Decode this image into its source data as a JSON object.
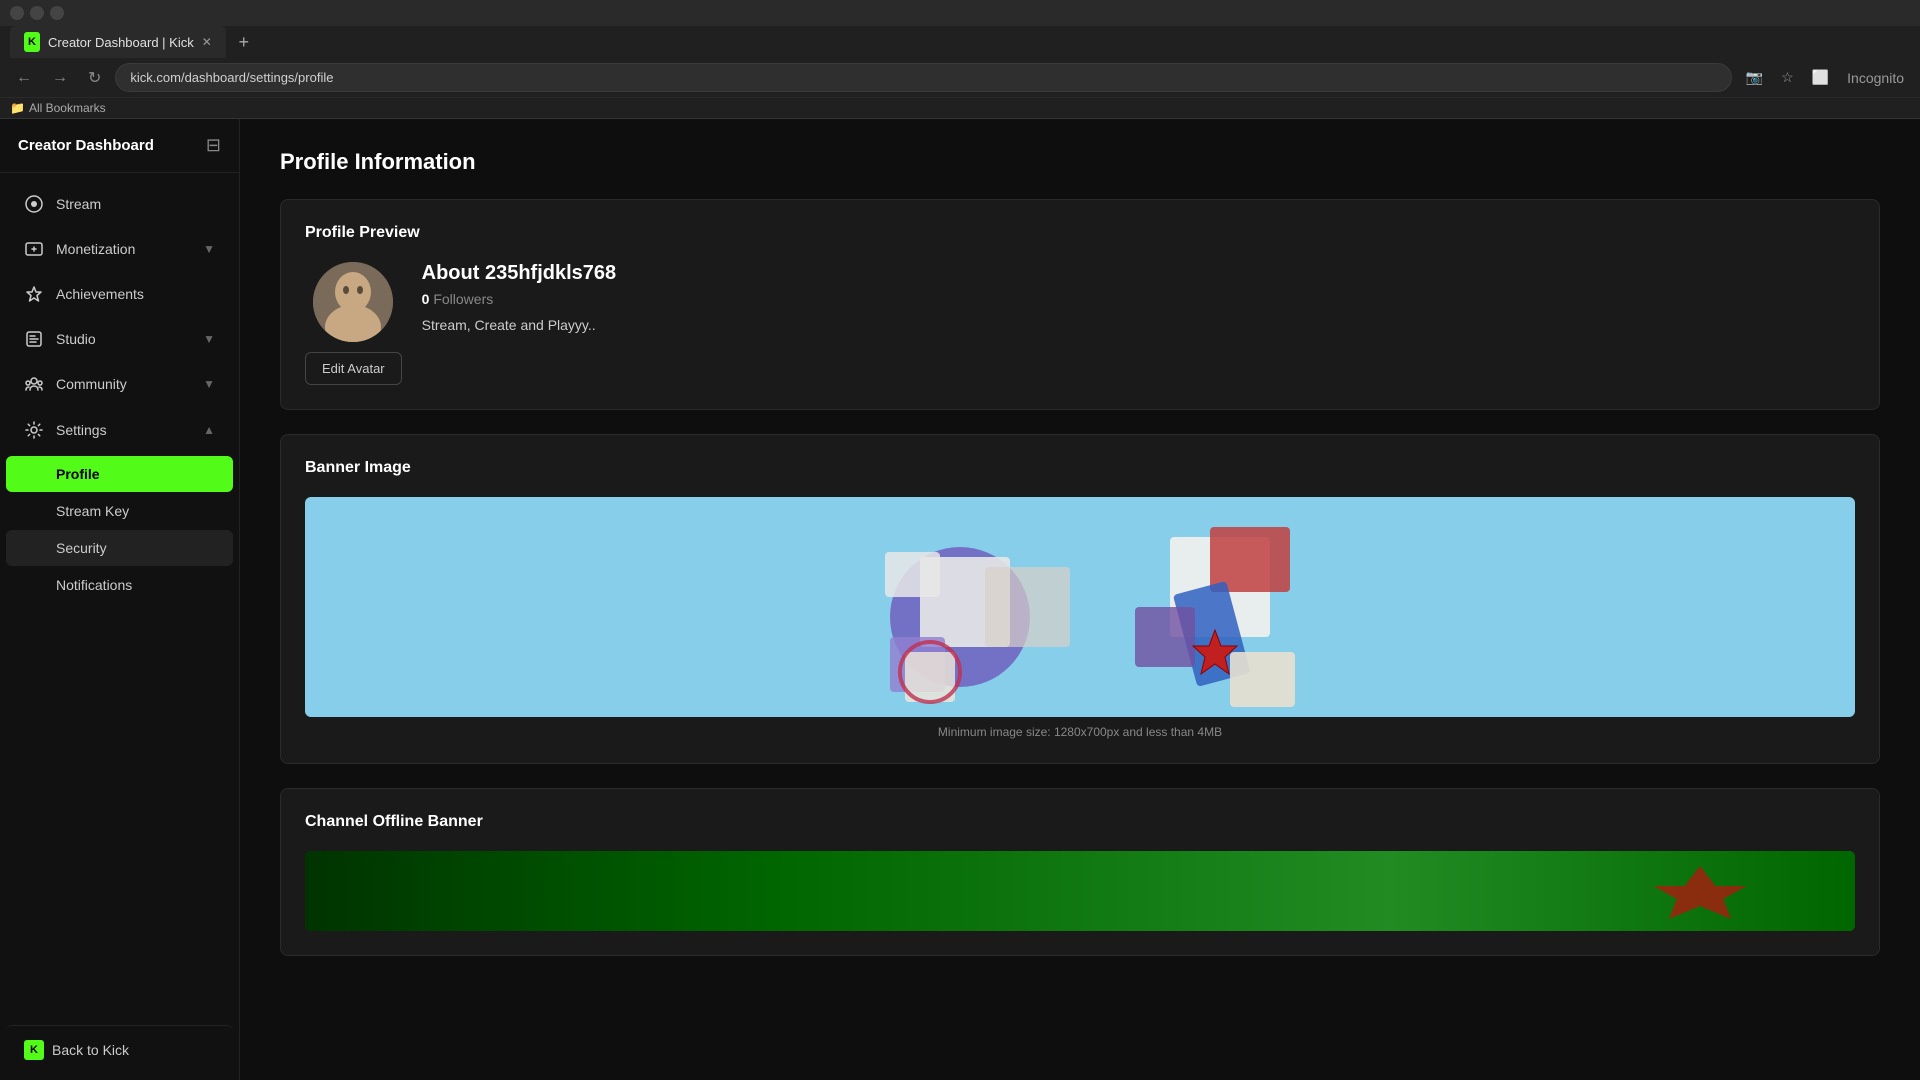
{
  "browser": {
    "tab_title": "Creator Dashboard | Kick",
    "url": "kick.com/dashboard/settings/profile",
    "incognito_label": "Incognito",
    "bookmarks_label": "All Bookmarks",
    "new_tab_label": "+"
  },
  "sidebar": {
    "title": "Creator Dashboard",
    "collapse_icon": "≡",
    "nav_items": [
      {
        "id": "stream",
        "label": "Stream",
        "icon": "stream"
      },
      {
        "id": "monetization",
        "label": "Monetization",
        "icon": "monetize",
        "has_chevron": true
      },
      {
        "id": "achievements",
        "label": "Achievements",
        "icon": "trophy"
      },
      {
        "id": "studio",
        "label": "Studio",
        "icon": "studio",
        "has_chevron": true
      },
      {
        "id": "community",
        "label": "Community",
        "icon": "community",
        "has_chevron": true
      }
    ],
    "settings": {
      "label": "Settings",
      "icon": "settings",
      "chevron": "▲",
      "children": [
        {
          "id": "profile",
          "label": "Profile",
          "active": true
        },
        {
          "id": "stream-key",
          "label": "Stream Key"
        },
        {
          "id": "security",
          "label": "Security",
          "hovered": true
        },
        {
          "id": "notifications",
          "label": "Notifications"
        }
      ]
    },
    "back_to_kick": {
      "label": "Back to Kick",
      "icon": "kick"
    }
  },
  "main": {
    "page_title": "Profile Information",
    "profile_preview": {
      "section_title": "Profile Preview",
      "username": "About 235hfjdkls768",
      "followers_count": "0",
      "followers_label": "Followers",
      "bio": "Stream, Create and Playyy..",
      "edit_avatar_label": "Edit Avatar"
    },
    "banner_image": {
      "section_title": "Banner Image",
      "caption": "Minimum image size: 1280x700px and less than 4MB"
    },
    "offline_banner": {
      "section_title": "Channel Offline Banner"
    }
  }
}
